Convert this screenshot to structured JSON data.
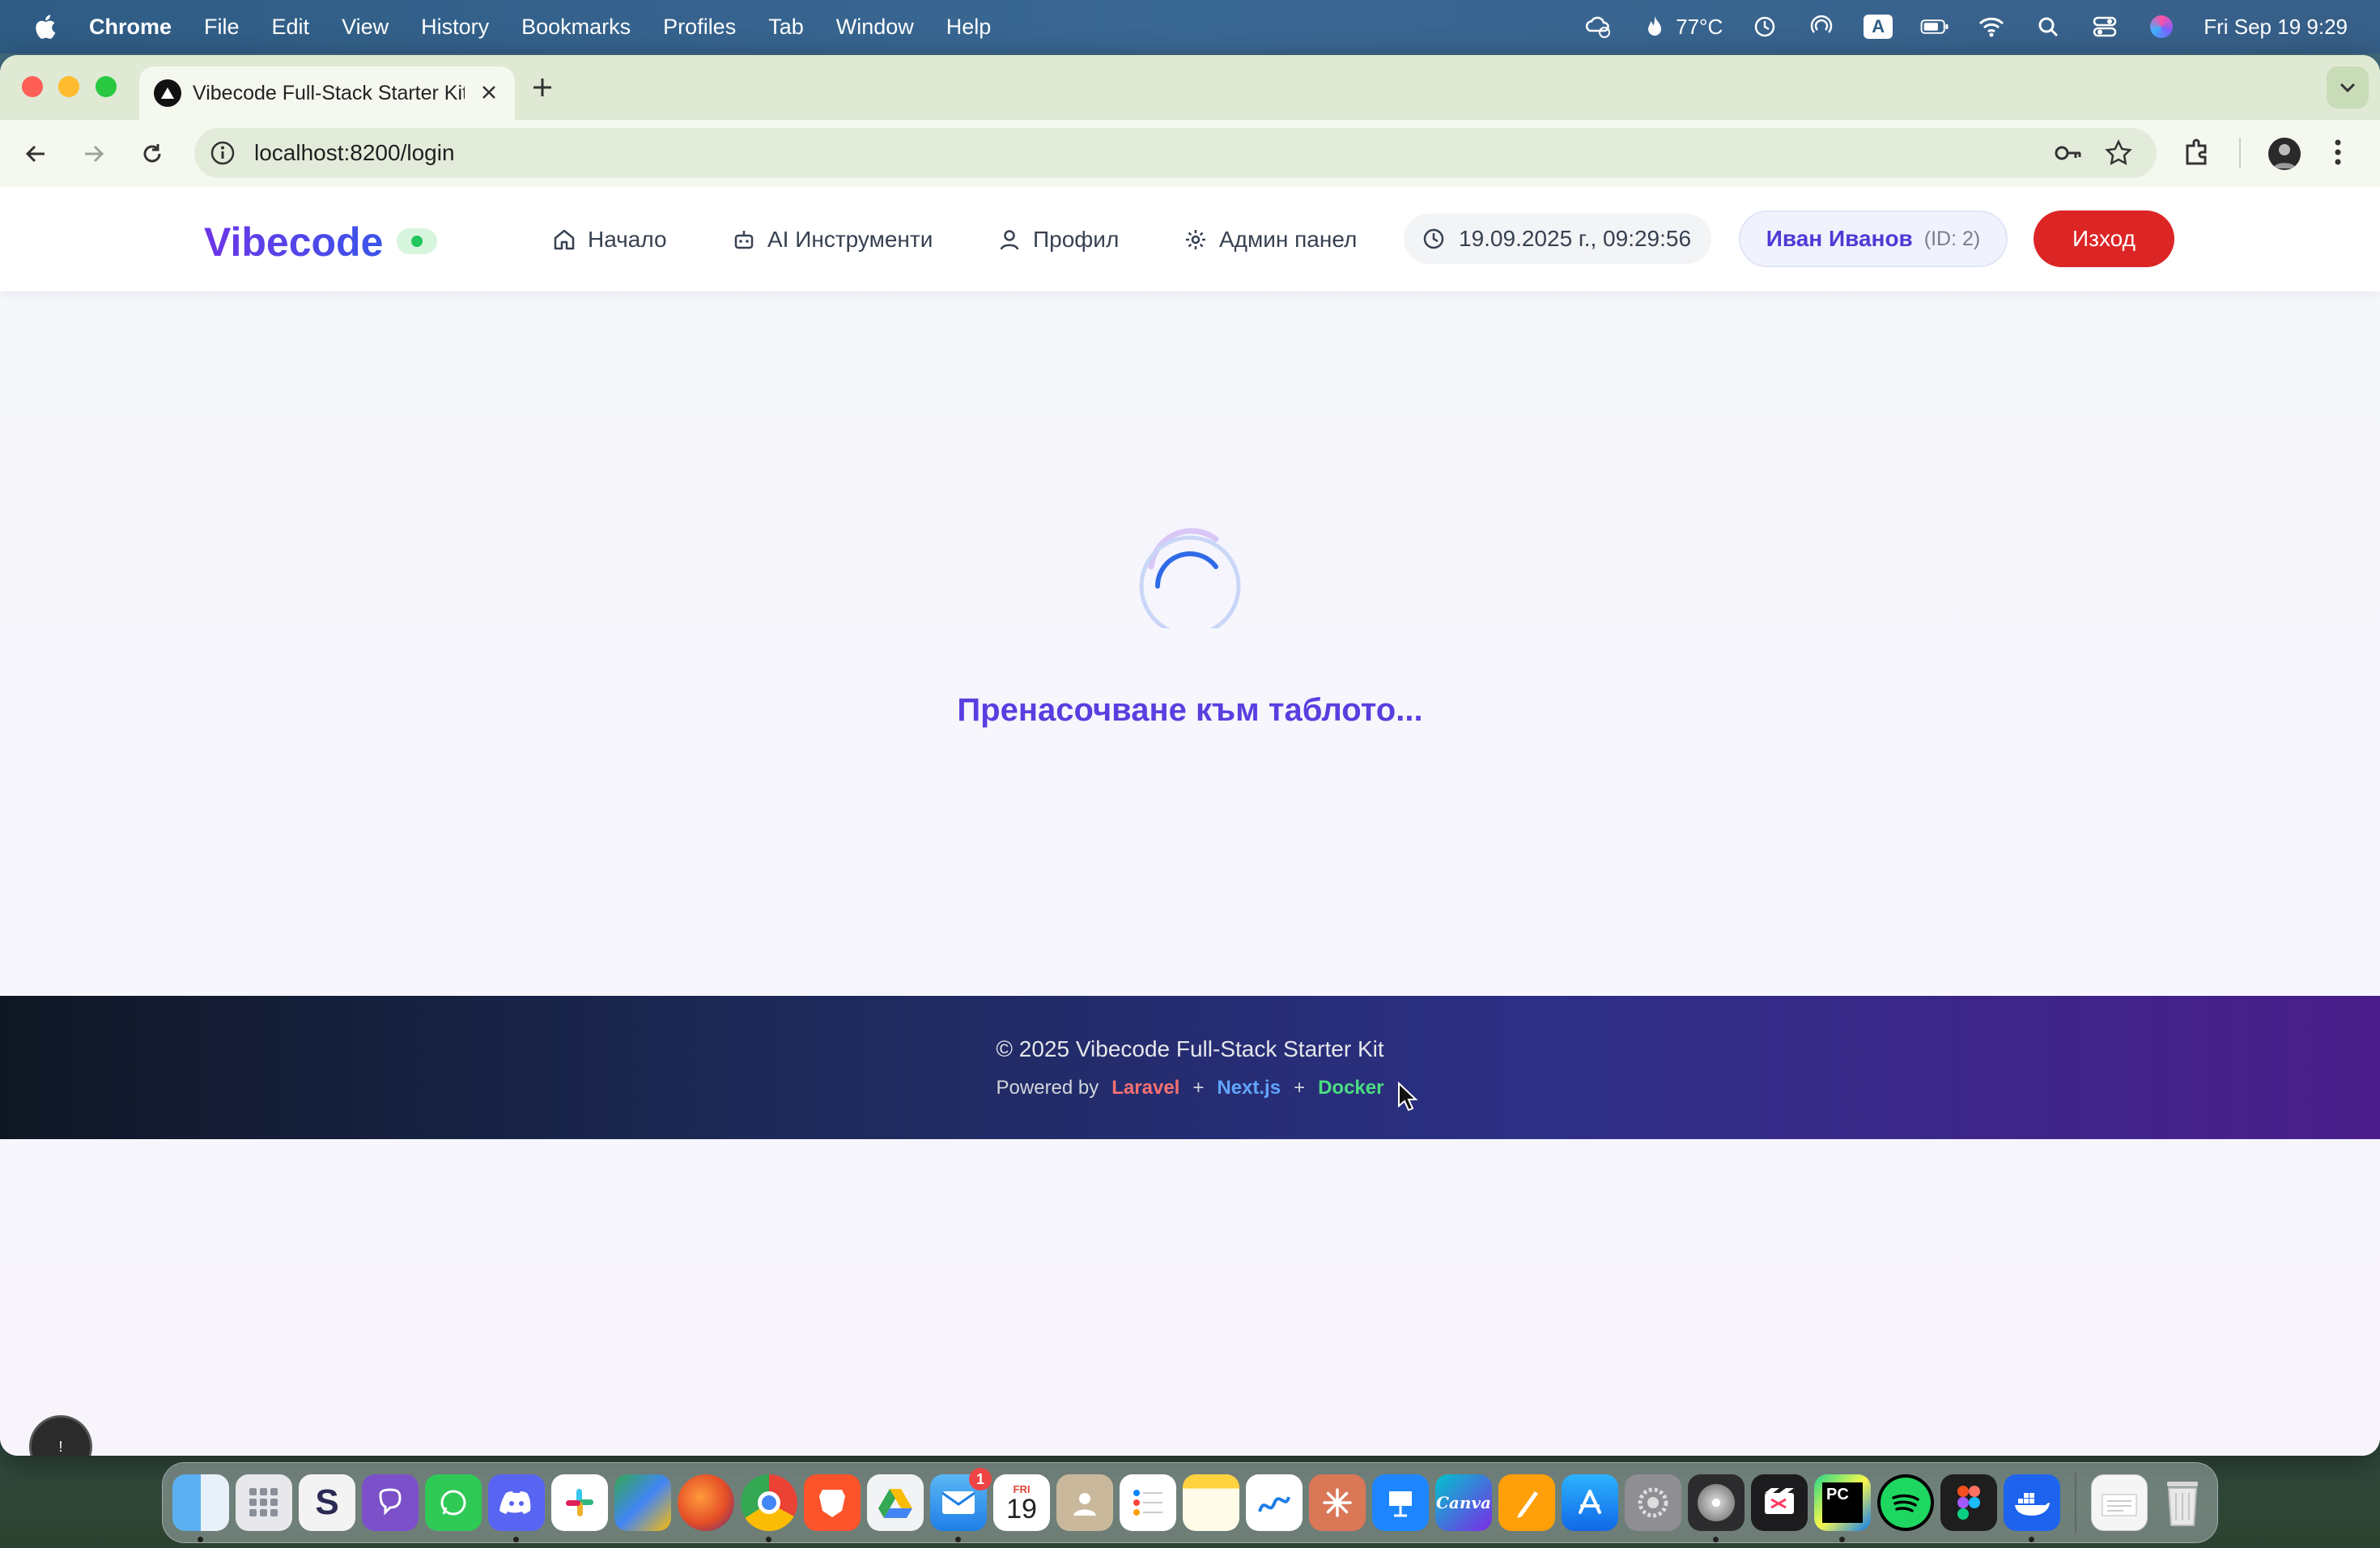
{
  "menubar": {
    "app_name": "Chrome",
    "items": [
      "File",
      "Edit",
      "View",
      "History",
      "Bookmarks",
      "Profiles",
      "Tab",
      "Window",
      "Help"
    ],
    "temperature": "77°C",
    "keyboard_letter": "A",
    "datetime": "Fri Sep 19  9:29"
  },
  "browser": {
    "tab_title": "Vibecode Full-Stack Starter Kit",
    "url": "localhost:8200/login"
  },
  "header": {
    "logo": "Vibecode",
    "nav": [
      {
        "label": "Начало",
        "icon": "home-icon"
      },
      {
        "label": "AI Инструменти",
        "icon": "robot-icon"
      },
      {
        "label": "Профил",
        "icon": "user-icon"
      },
      {
        "label": "Админ панел",
        "icon": "gear-icon"
      }
    ],
    "clock": "19.09.2025 г., 09:29:56",
    "user_name": "Иван Иванов",
    "user_id": "(ID: 2)",
    "logout_label": "Изход"
  },
  "main": {
    "redirect_text": "Пренасочване към таблото..."
  },
  "footer": {
    "copyright": "© 2025 Vibecode Full-Stack Starter Kit",
    "powered_by": "Powered by",
    "laravel": "Laravel",
    "plus": "+",
    "nextjs": "Next.js",
    "docker": "Docker"
  },
  "fab_label": "!",
  "dock": {
    "mail_badge": "1",
    "calendar_day": "19",
    "calendar_month": "FRI",
    "canva_label": "Canva",
    "pycharm_label": "PC"
  },
  "colors": {
    "accent": "#5b3ee0",
    "logout": "#dc2626",
    "status": "#22c55e"
  }
}
